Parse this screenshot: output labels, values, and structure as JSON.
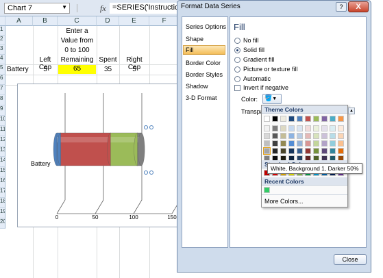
{
  "excel": {
    "name_box": "Chart 7",
    "fx_label": "fx",
    "formula": "=SERIES('Instruction",
    "columns": [
      "A",
      "B",
      "C",
      "D",
      "E",
      "F"
    ],
    "rows": [
      "1",
      "2",
      "3",
      "4",
      "5",
      "6",
      "7",
      "8",
      "9",
      "10",
      "11",
      "12",
      "13",
      "14",
      "15",
      "16",
      "17",
      "18",
      "19",
      "20"
    ],
    "header_note_lines": [
      "Enter a",
      "Value from",
      "0 to 100"
    ],
    "headers": {
      "left_cap": "Left Cap",
      "remaining": "Remaining",
      "spent": "Spent",
      "right_cap": "Right Cap"
    },
    "data_row": {
      "label": "Battery",
      "left_cap": "5",
      "remaining": "65",
      "spent": "35",
      "right_cap": "5"
    }
  },
  "chart_data": {
    "type": "bar",
    "orientation": "horizontal",
    "stacked": true,
    "three_d": true,
    "categories": [
      "Battery"
    ],
    "series": [
      {
        "name": "Left Cap",
        "values": [
          5
        ],
        "color": "#4f81bd"
      },
      {
        "name": "Remaining",
        "values": [
          65
        ],
        "color": "#c0504d"
      },
      {
        "name": "Spent",
        "values": [
          35
        ],
        "color": "#9bbb59"
      },
      {
        "name": "Right Cap",
        "values": [
          5
        ],
        "color": "#7f7f7f"
      }
    ],
    "x_ticks": [
      "0",
      "50",
      "100",
      "150"
    ],
    "xlim": [
      0,
      150
    ],
    "category_label": "Battery",
    "grid": true
  },
  "dialog": {
    "title": "Format Data Series",
    "help": "?",
    "close_x": "X",
    "nav": [
      "Series Options",
      "Shape",
      "Fill",
      "Border Color",
      "Border Styles",
      "Shadow",
      "3-D Format"
    ],
    "selected_nav": "Fill",
    "fill_heading": "Fill",
    "options": [
      {
        "label": "No fill",
        "checked": false
      },
      {
        "label": "Solid fill",
        "checked": true
      },
      {
        "label": "Gradient fill",
        "checked": false
      },
      {
        "label": "Picture or texture fill",
        "checked": false
      },
      {
        "label": "Automatic",
        "checked": false
      }
    ],
    "invert_label": "Invert if negative",
    "color_label": "Color:",
    "transparency_label": "Transpa",
    "palette": {
      "theme_header": "Theme Colors",
      "standard_header": "Standard Colors",
      "recent_header": "Recent Colors",
      "more_colors": "More Colors...",
      "tooltip": "White, Background 1, Darker 50%",
      "recent_color": "#33cc66"
    },
    "close_button": "Close"
  }
}
